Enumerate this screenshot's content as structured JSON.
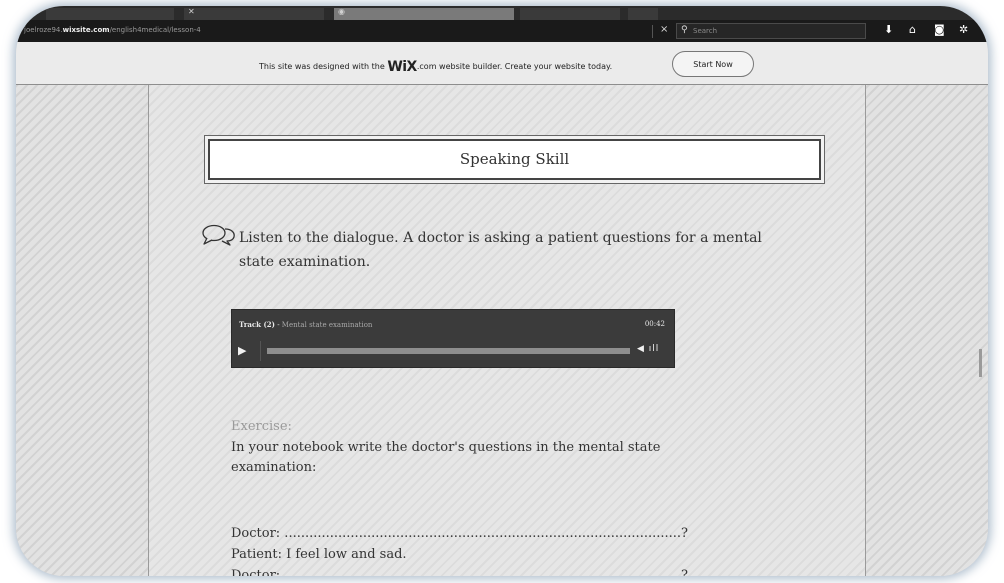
{
  "browser": {
    "url_prefix": "joelroze94.",
    "url_domain": "wixsite.com",
    "url_path": "/english4medical/lesson-4",
    "close_label": "×",
    "search_placeholder": "Search",
    "icons": [
      "download-icon",
      "home-icon",
      "pocket-icon",
      "extension-icon"
    ]
  },
  "wix_banner": {
    "text_before": "This site was designed with the ",
    "brand": "WiX",
    "text_after": ".com website builder. Create your website today.",
    "button_label": "Start Now"
  },
  "lesson": {
    "title": "Speaking Skill",
    "instruction": "Listen to the dialogue. A doctor is asking a patient questions for a mental state examination.",
    "audio": {
      "track_label": "Track (2)",
      "track_name": "Mental state examination",
      "duration": "00:42",
      "progress": 0
    },
    "exercise_label": "Exercise:",
    "exercise_text": "In your notebook write the doctor's questions in the mental state examination:",
    "dialogue": [
      "Doctor: ................................................................................................?",
      "Patient: I feel low and sad.",
      "Doctor: ................................................................................................?"
    ]
  }
}
